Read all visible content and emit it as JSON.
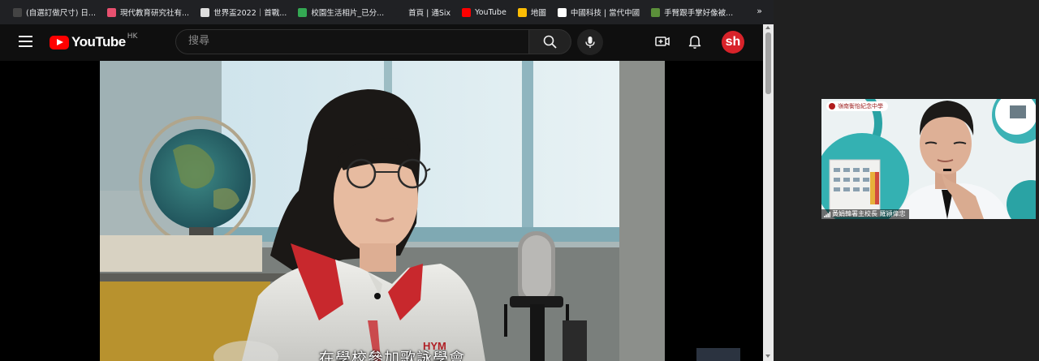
{
  "bookmarks": [
    {
      "label": "(自選訂做尺寸) 日...",
      "icon": "bookmark-icon",
      "color": "#444444"
    },
    {
      "label": "現代教育研究社有...",
      "icon": "book-icon",
      "color": "#e8506f"
    },
    {
      "label": "世界盃2022｜首戰...",
      "icon": "globe-icon",
      "color": "#dddddd"
    },
    {
      "label": "校園生活相片_已分...",
      "icon": "google-drive-icon",
      "color": "#34a853"
    },
    {
      "label": "首頁 | 通Six",
      "icon": "blank-page-icon",
      "color": "#202124"
    },
    {
      "label": "YouTube",
      "icon": "youtube-icon",
      "color": "#ff0000"
    },
    {
      "label": "地圖",
      "icon": "maps-pin-icon",
      "color": "#fbbc04"
    },
    {
      "label": "中國科技 | 當代中國",
      "icon": "page-icon",
      "color": "#ffffff"
    },
    {
      "label": "手臂跟手掌好像被...",
      "icon": "forum-icon",
      "color": "#5b8f3a"
    }
  ],
  "bookmarks_more": "»",
  "youtube": {
    "logo_text": "YouTube",
    "region": "HK",
    "search_placeholder": "搜尋",
    "avatar_text": "sh"
  },
  "video": {
    "subtitle": "在學校參加歌詠學會",
    "jacket_text": "HYM"
  },
  "speaker": {
    "name_label": "黃娟韓署主校長 羅潁偉忠",
    "school_banner": "嶺南衡怡紀念中學"
  },
  "colors": {
    "youtube_red": "#ff0000",
    "background": "#202020",
    "yt_dark": "#0f0f0f"
  }
}
